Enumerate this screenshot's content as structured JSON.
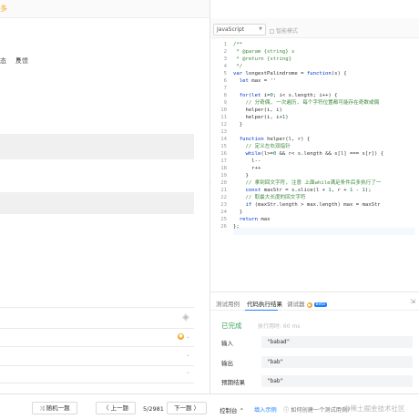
{
  "left": {
    "orange_tab": "多",
    "tabs": [
      {
        "label": "态",
        "icon": "flag-icon"
      },
      {
        "label": "反馈",
        "icon": "flag-icon"
      }
    ]
  },
  "toolbar": {
    "language": "JavaScript",
    "smart_mode_label": "智能模式"
  },
  "editor": {
    "line_numbers": [
      "1",
      "2",
      "3",
      "4",
      "5",
      "6",
      "7",
      "8",
      "9",
      "10",
      "11",
      "12",
      "13",
      "14",
      "15",
      "16",
      "17",
      "18",
      "19",
      "20",
      "21",
      "22",
      "23",
      "24",
      "25",
      "26"
    ],
    "lines": [
      "/**",
      " * @param {string} s",
      " * @return {string}",
      " */",
      "var longestPalindrome = function(s) {",
      "  let max = ''",
      "",
      "  for(let i=0; i< s.length; i++) {",
      "    // 分奇偶, 一次遍历, 每个字符位置都可能存在奇数或偶",
      "    helper(i, i)",
      "    helper(i, i+1)",
      "  }",
      "",
      "  function helper(l, r) {",
      "    // 定义左右双指针",
      "    while(l>=0 && r< s.length && s[l] === s[r]) {",
      "      l--",
      "      r++",
      "    }",
      "    // 拿到回文字符, 注意 上面while满足条件后多执行了一",
      "    const maxStr = s.slice(l + 1, r + 1 - 1);",
      "    // 取最大长度的回文字符",
      "    if (maxStr.length > max.length) max = maxStr",
      "  }",
      "  return max",
      "};"
    ]
  },
  "result": {
    "tabs": [
      "测试用例",
      "代码执行结果",
      "调试器"
    ],
    "beta_label": "Beta",
    "status": "已完成",
    "exec_time_label": "执行用时: 60 ms",
    "rows": [
      {
        "label": "输入",
        "value": "\"babad\""
      },
      {
        "label": "输出",
        "value": "\"bab\""
      },
      {
        "label": "预期结果",
        "value": "\"bab\""
      }
    ]
  },
  "bottom": {
    "random_label": "⤨ 随机一题",
    "prev_label": "〈 上一题",
    "page": "5/2981",
    "next_label": "下一题 〉",
    "console_label": "控制台 ⌃",
    "example_label": "填入示例",
    "help_label": "ⓘ 如何创建一个测试用例?"
  },
  "watermark": "@稀土掘金技术社区"
}
